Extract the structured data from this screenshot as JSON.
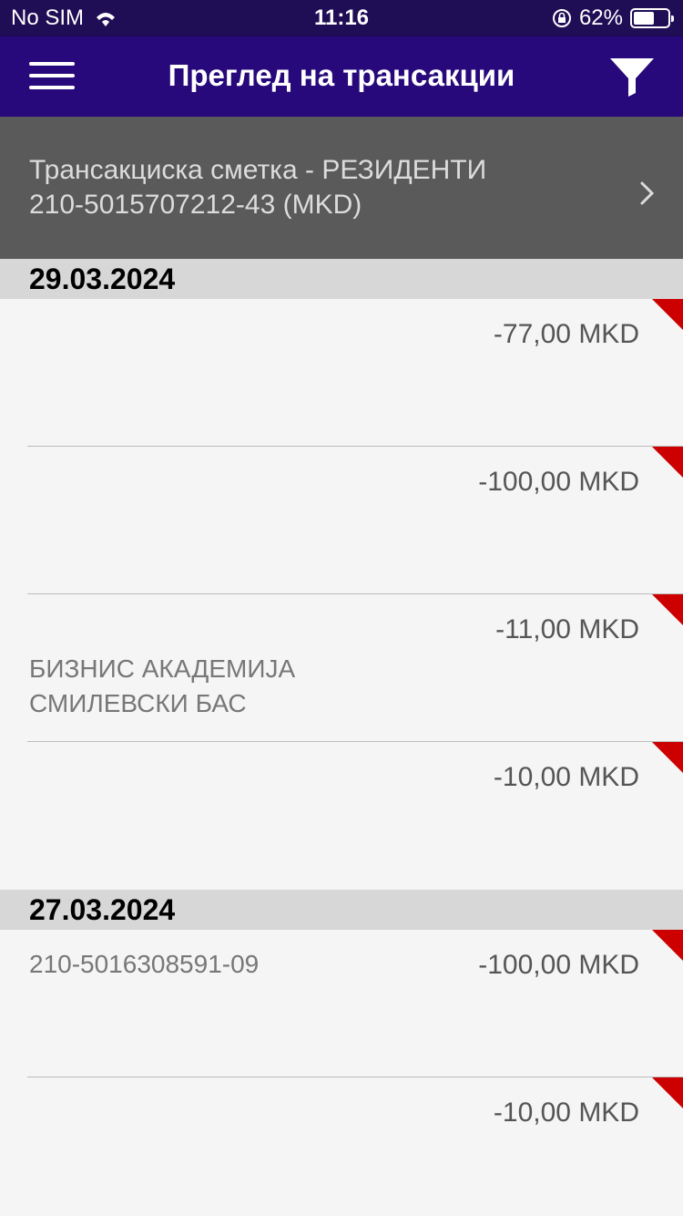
{
  "status": {
    "carrier": "No SIM",
    "time": "11:16",
    "battery": "62%",
    "battery_level": 0.62
  },
  "header": {
    "title": "Преглед на трансакции"
  },
  "account": {
    "name": "Трансакциска сметка - РЕЗИДЕНТИ",
    "number": "210-5015707212-43 (MKD)"
  },
  "groups": [
    {
      "date": "29.03.2024",
      "transactions": [
        {
          "account": "",
          "amount": "-77,00 MKD",
          "desc1": "",
          "desc2": ""
        },
        {
          "account": "",
          "amount": "-100,00 MKD",
          "desc1": "",
          "desc2": ""
        },
        {
          "account": "",
          "amount": "-11,00 MKD",
          "desc1": "БИЗНИС АКАДЕМИЈА",
          "desc2": "СМИЛЕВСКИ БАС"
        },
        {
          "account": "",
          "amount": "-10,00 MKD",
          "desc1": "",
          "desc2": ""
        }
      ]
    },
    {
      "date": "27.03.2024",
      "transactions": [
        {
          "account": "210-5016308591-09",
          "amount": "-100,00 MKD",
          "desc1": "",
          "desc2": ""
        },
        {
          "account": "",
          "amount": "-10,00 MKD",
          "desc1": "",
          "desc2": ""
        }
      ]
    }
  ],
  "colors": {
    "statusbar": "#1f0d55",
    "navbar": "#27097b",
    "account_bg": "#5a5a5a",
    "date_bg": "#d7d7d7",
    "corner": "#cc0000"
  }
}
